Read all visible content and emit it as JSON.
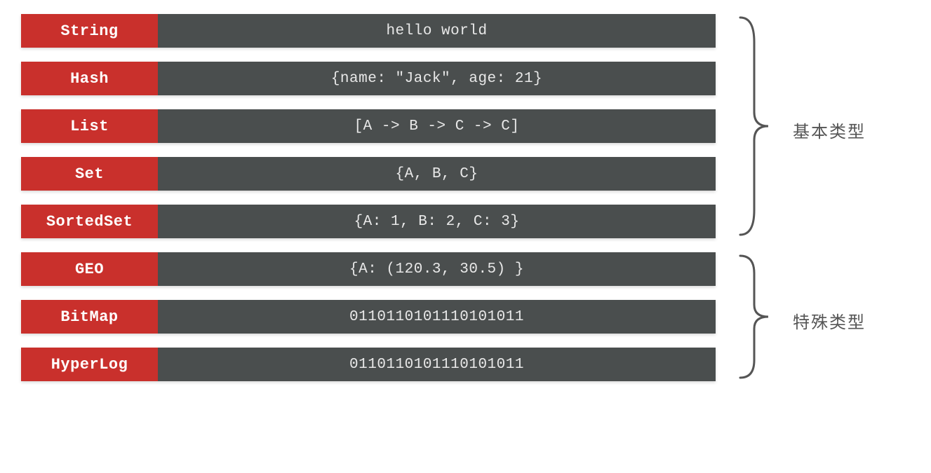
{
  "groups": [
    {
      "label": "基本类型",
      "startIndex": 0,
      "endIndex": 4,
      "items": [
        {
          "name": "String",
          "value": "hello world"
        },
        {
          "name": "Hash",
          "value": "{name: \"Jack\", age: 21}"
        },
        {
          "name": "List",
          "value": "[A -> B -> C -> C]"
        },
        {
          "name": "Set",
          "value": "{A, B, C}"
        },
        {
          "name": "SortedSet",
          "value": "{A: 1, B: 2, C: 3}"
        }
      ]
    },
    {
      "label": "特殊类型",
      "startIndex": 5,
      "endIndex": 7,
      "items": [
        {
          "name": "GEO",
          "value": "{A: (120.3,  30.5) }"
        },
        {
          "name": "BitMap",
          "value": "0110110101110101011"
        },
        {
          "name": "HyperLog",
          "value": "0110110101110101011"
        }
      ]
    }
  ],
  "colors": {
    "labelBg": "#c9302c",
    "valueBg": "#4a4e4e",
    "textLight": "#e8e8e8",
    "annotation": "#555555"
  },
  "allItems": [
    {
      "name": "String",
      "value": "hello world"
    },
    {
      "name": "Hash",
      "value": "{name: \"Jack\", age: 21}"
    },
    {
      "name": "List",
      "value": "[A -> B -> C -> C]"
    },
    {
      "name": "Set",
      "value": "{A, B, C}"
    },
    {
      "name": "SortedSet",
      "value": "{A: 1, B: 2, C: 3}"
    },
    {
      "name": "GEO",
      "value": "{A: (120.3,  30.5) }"
    },
    {
      "name": "BitMap",
      "value": "0110110101110101011"
    },
    {
      "name": "HyperLog",
      "value": "0110110101110101011"
    }
  ]
}
